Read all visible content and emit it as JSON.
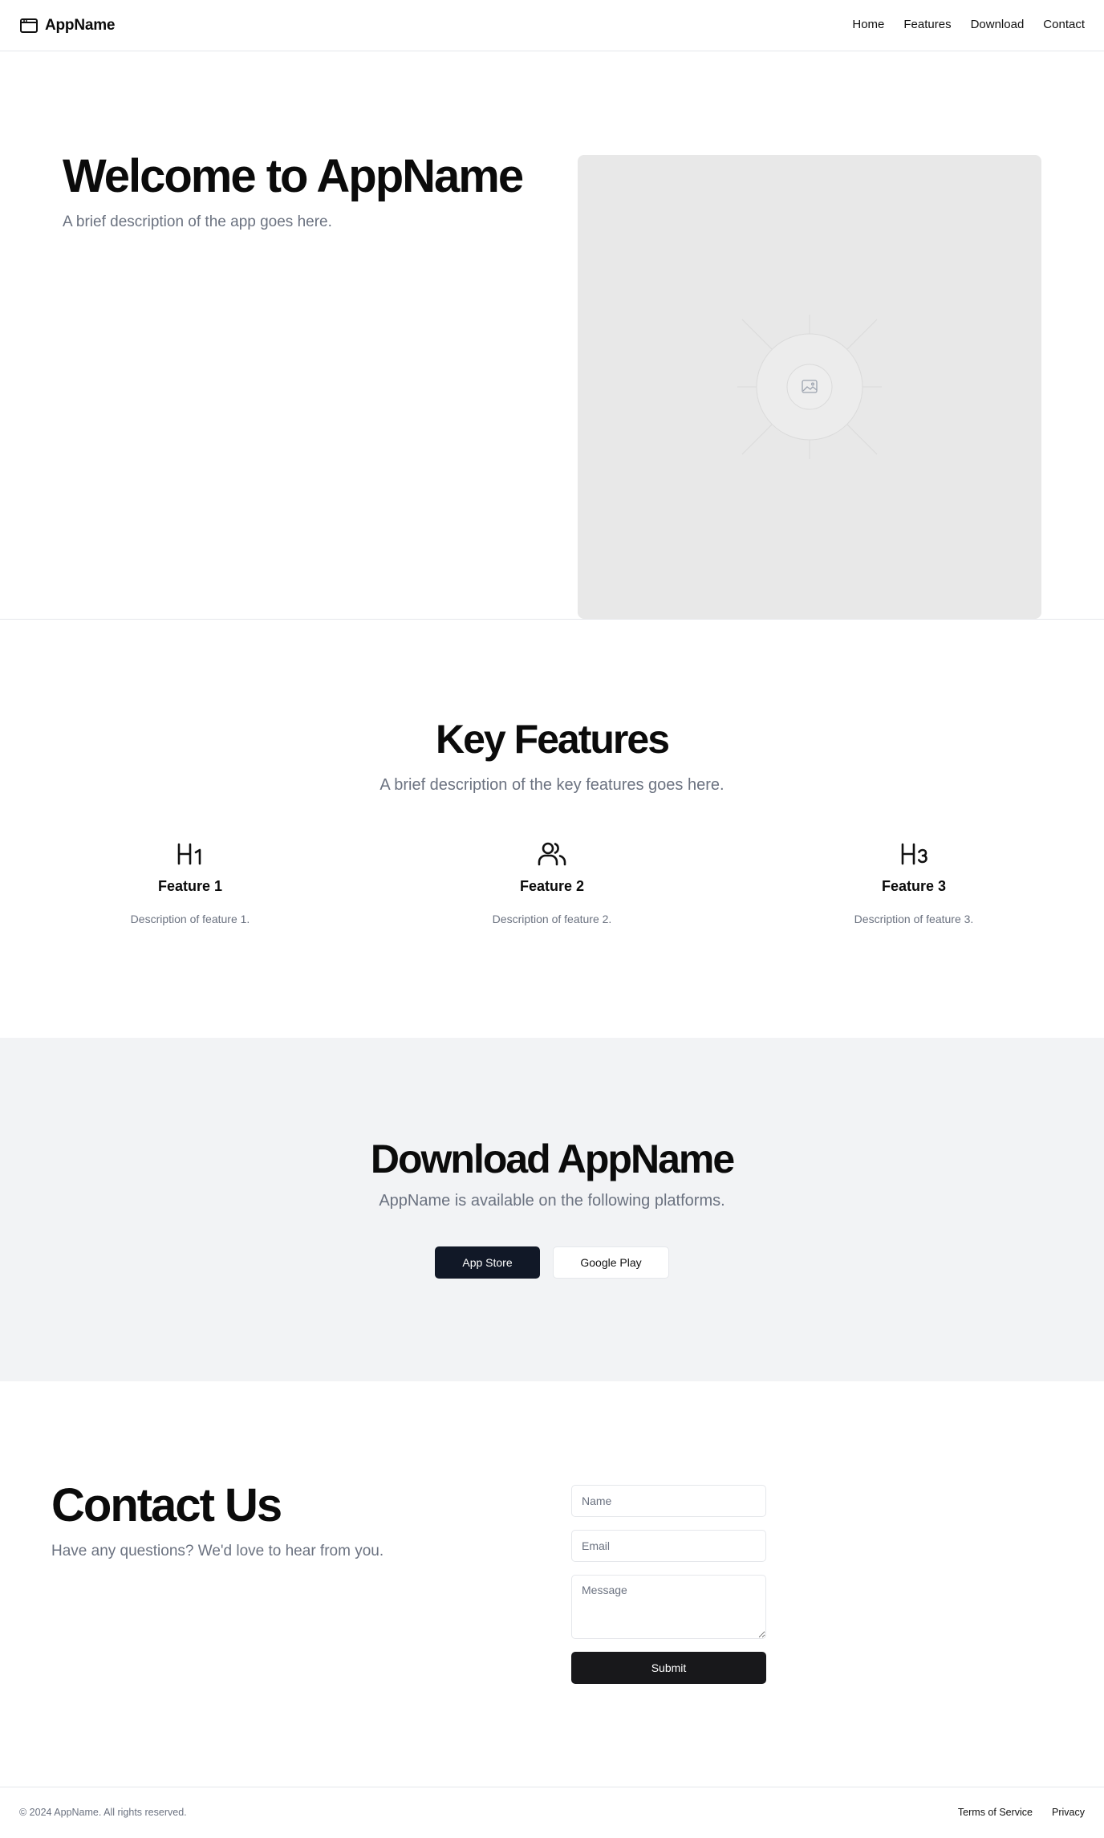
{
  "header": {
    "brand": "AppName",
    "brand_icon": "browser-window-icon",
    "nav": [
      "Home",
      "Features",
      "Download",
      "Contact"
    ]
  },
  "hero": {
    "title": "Welcome to AppName",
    "description": "A brief description of the app goes here.",
    "image_icon": "image-placeholder-icon"
  },
  "features": {
    "title": "Key Features",
    "description": "A brief description of the key features goes here.",
    "items": [
      {
        "icon": "heading-1-icon",
        "glyph": "H1",
        "title": "Feature 1",
        "description": "Description of feature 1."
      },
      {
        "icon": "users-icon",
        "glyph": "",
        "title": "Feature 2",
        "description": "Description of feature 2."
      },
      {
        "icon": "heading-3-icon",
        "glyph": "H3",
        "title": "Feature 3",
        "description": "Description of feature 3."
      }
    ]
  },
  "download": {
    "title": "Download AppName",
    "description": "AppName is available on the following platforms.",
    "app_store_label": "App Store",
    "google_play_label": "Google Play"
  },
  "contact": {
    "title": "Contact Us",
    "description": "Have any questions? We'd love to hear from you.",
    "name_placeholder": "Name",
    "email_placeholder": "Email",
    "message_placeholder": "Message",
    "submit_label": "Submit"
  },
  "footer": {
    "copyright": "© 2024 AppName. All rights reserved.",
    "terms_label": "Terms of Service",
    "privacy_label": "Privacy"
  },
  "colors": {
    "muted_text": "#6b7280",
    "primary_button": "#111827",
    "section_bg": "#f2f3f5",
    "border": "#e5e7eb"
  }
}
